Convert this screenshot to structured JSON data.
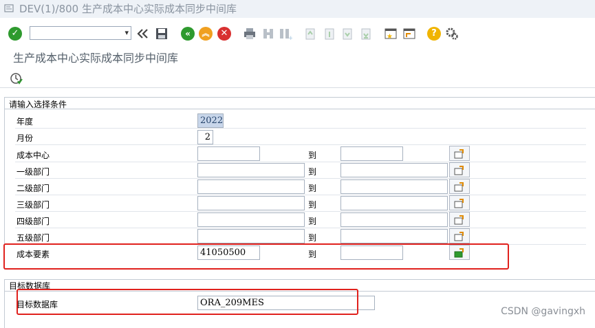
{
  "window": {
    "title": "DEV(1)/800 生产成本中心实际成本同步中间库"
  },
  "toolbar": {
    "command_value": "",
    "icons": [
      "enter-icon",
      "back-icon",
      "save-icon",
      "back-green-icon",
      "exit-icon",
      "cancel-icon",
      "print-icon",
      "find-icon",
      "find-next-icon",
      "first-page-icon",
      "prev-page-icon",
      "next-page-icon",
      "last-page-icon",
      "create-session-icon",
      "shortcut-icon",
      "help-icon",
      "settings-icon"
    ]
  },
  "screen": {
    "title": "生产成本中心实际成本同步中间库"
  },
  "selection": {
    "group_title": "请输入选择条件",
    "to_label": "到",
    "rows": [
      {
        "label": "年度",
        "value": "2022"
      },
      {
        "label": "月份",
        "value": "2"
      },
      {
        "label": "成本中心",
        "low": "",
        "high": ""
      },
      {
        "label": "一级部门",
        "low": "",
        "high": ""
      },
      {
        "label": "二级部门",
        "low": "",
        "high": ""
      },
      {
        "label": "三级部门",
        "low": "",
        "high": ""
      },
      {
        "label": "四级部门",
        "low": "",
        "high": ""
      },
      {
        "label": "五级部门",
        "low": "",
        "high": ""
      },
      {
        "label": "成本要素",
        "low": "41050500",
        "high": ""
      }
    ]
  },
  "target": {
    "group_title": "目标数据库",
    "label": "目标数据库",
    "value": "ORA_209MES"
  },
  "watermark": "CSDN @gavingxh",
  "colors": {
    "highlight": "#e0201c",
    "enter_green": "#2e9a2e",
    "cancel_red": "#d83030",
    "exit_orange": "#f0a020",
    "help_yellow": "#f0b400"
  }
}
